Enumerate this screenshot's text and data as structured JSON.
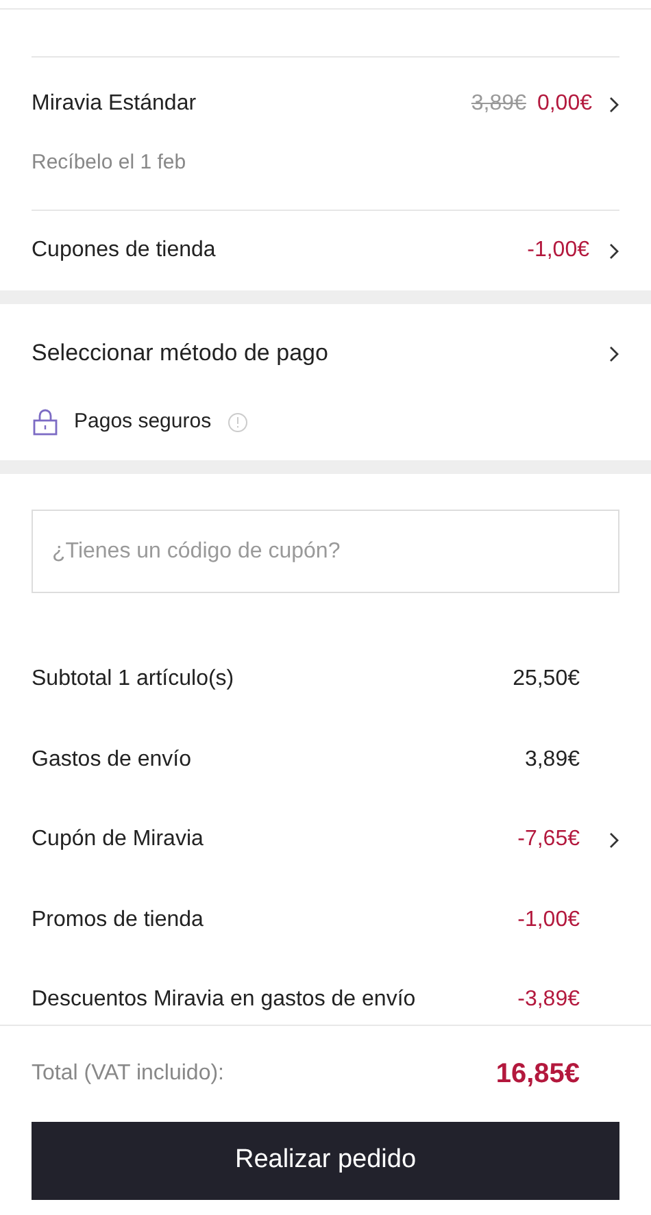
{
  "shipping": {
    "name": "Miravia Estándar",
    "old_price": "3,89€",
    "price": "0,00€",
    "delivery": "Recíbelo el 1 feb"
  },
  "store_coupons": {
    "label": "Cupones de tienda",
    "value": "-1,00€"
  },
  "payment": {
    "label": "Seleccionar método de pago",
    "secure_label": "Pagos seguros"
  },
  "coupon_field": {
    "placeholder": "¿Tienes un código de cupón?"
  },
  "summary": [
    {
      "label": "Subtotal 1 artículo(s)",
      "value": "25,50€",
      "discount": false,
      "chevron": false
    },
    {
      "label": "Gastos de envío",
      "value": "3,89€",
      "discount": false,
      "chevron": false
    },
    {
      "label": "Cupón de Miravia",
      "value": "-7,65€",
      "discount": true,
      "chevron": true
    },
    {
      "label": "Promos de tienda",
      "value": "-1,00€",
      "discount": true,
      "chevron": false
    },
    {
      "label": "Descuentos Miravia en gastos de envío",
      "value": "-3,89€",
      "discount": true,
      "chevron": false
    }
  ],
  "total": {
    "label": "Total (VAT incluido):",
    "value": "16,85€"
  },
  "order_button": "Realizar pedido"
}
